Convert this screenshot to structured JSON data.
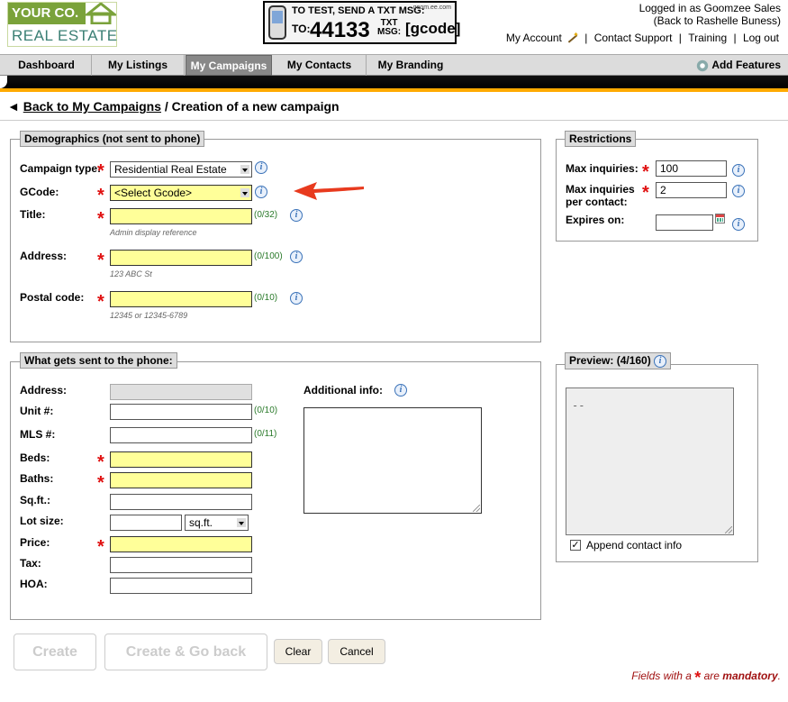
{
  "logo": {
    "line1": "YOUR CO.",
    "line2": "REAL ESTATE"
  },
  "banner": {
    "line1": "TO TEST, SEND A TXT MSG:",
    "brand": "goom.ee.com",
    "to": "TO:",
    "number": "44133",
    "txt": "TXT",
    "msg": "MSG:",
    "gcode": "[gcode]"
  },
  "user": {
    "logged_in": "Logged in as Goomzee Sales",
    "back_to": "(Back to Rashelle Buness)"
  },
  "toplinks": {
    "account": "My Account",
    "support": "Contact Support",
    "training": "Training",
    "logout": "Log out",
    "sep": "|"
  },
  "nav": {
    "tabs": [
      "Dashboard",
      "My Listings",
      "My Campaigns",
      "My Contacts",
      "My Branding"
    ],
    "active": "My Campaigns",
    "add_features": "Add Features"
  },
  "breadcrumb": {
    "arrow": "◄",
    "back": "Back to My Campaigns",
    "current": " / Creation of a new campaign"
  },
  "demographics": {
    "legend": "Demographics (not sent to phone)",
    "campaign_type_label": "Campaign type:",
    "campaign_type_value": "Residential Real Estate",
    "gcode_label": "GCode:",
    "gcode_value": "<Select Gcode>",
    "title_label": "Title:",
    "title_count": "(0/32)",
    "title_hint": "Admin display reference",
    "address_label": "Address:",
    "address_count": "(0/100)",
    "address_hint": "123 ABC St",
    "postal_label": "Postal code:",
    "postal_count": "(0/10)",
    "postal_hint": "12345 or 12345-6789"
  },
  "phone": {
    "legend": "What gets sent to the phone:",
    "address_label": "Address:",
    "unit_label": "Unit #:",
    "unit_count": "(0/10)",
    "mls_label": "MLS #:",
    "mls_count": "(0/11)",
    "beds_label": "Beds:",
    "baths_label": "Baths:",
    "sqft_label": "Sq.ft.:",
    "lot_label": "Lot size:",
    "lot_unit": "sq.ft.",
    "price_label": "Price:",
    "tax_label": "Tax:",
    "hoa_label": "HOA:",
    "additional_label": "Additional info:"
  },
  "restrictions": {
    "legend": "Restrictions",
    "max_inq_label": "Max inquiries:",
    "max_inq_value": "100",
    "max_per_label1": "Max inquiries",
    "max_per_label2": "per contact:",
    "max_per_value": "2",
    "expires_label": "Expires on:"
  },
  "preview": {
    "legend": "Preview: (4/160)",
    "content": "--",
    "append_label": "Append contact info",
    "append_checked": true
  },
  "buttons": {
    "create": "Create",
    "create_back": "Create & Go back",
    "clear": "Clear",
    "cancel": "Cancel"
  },
  "footnote": {
    "pre": "Fields with a ",
    "star": "*",
    "mid": " are ",
    "post": "mandatory",
    "end": "."
  },
  "colors": {
    "required_star": "#e01010",
    "field_highlight": "#ffff99",
    "accent_stripe": "#ffaa00",
    "counter": "#2a7a2a",
    "pointer_arrow": "#e83a1e"
  }
}
